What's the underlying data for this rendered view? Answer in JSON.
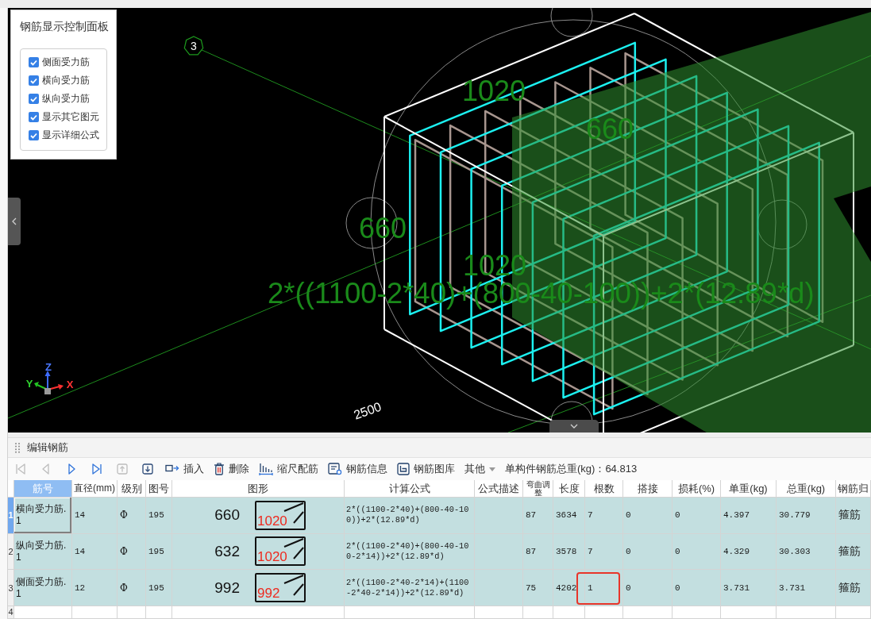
{
  "viewport": {
    "axis_marker": "3",
    "dimension_labels": [
      "1020",
      "660",
      "660",
      "1020"
    ],
    "formula_label": "2*((1100-2*40)+(800-40-100))+2*(12.89*d)",
    "length_label": "2500",
    "axis_letters": [
      "Z",
      "Y",
      "X"
    ]
  },
  "control_panel": {
    "title": "钢筋显示控制面板",
    "options": [
      {
        "label": "侧面受力筋",
        "checked": true
      },
      {
        "label": "横向受力筋",
        "checked": true
      },
      {
        "label": "纵向受力筋",
        "checked": true
      },
      {
        "label": "显示其它图元",
        "checked": true
      },
      {
        "label": "显示详细公式",
        "checked": true
      }
    ]
  },
  "edit_panel": {
    "title": "编辑钢筋",
    "navigation": [
      {
        "kind": "first",
        "disabled": true
      },
      {
        "kind": "previous",
        "disabled": true
      },
      {
        "kind": "next",
        "disabled": false
      },
      {
        "kind": "last",
        "disabled": false
      },
      {
        "kind": "up",
        "disabled": true
      },
      {
        "kind": "down",
        "disabled": false
      }
    ],
    "actions": [
      {
        "kind": "insert",
        "label": "插入"
      },
      {
        "kind": "delete",
        "label": "删除"
      },
      {
        "kind": "scale",
        "label": "缩尺配筋"
      },
      {
        "kind": "info",
        "label": "钢筋信息"
      },
      {
        "kind": "library",
        "label": "钢筋图库"
      },
      {
        "kind": "more",
        "label": "其他"
      }
    ],
    "total_weight": "单构件钢筋总重(kg)：64.813"
  },
  "table": {
    "columns": [
      {
        "label": "筋号",
        "selected": true
      },
      {
        "label": "直径(mm)",
        "selected": false
      },
      {
        "label": "级别",
        "selected": false
      },
      {
        "label": "图号",
        "selected": false
      },
      {
        "label": "图形",
        "selected": false
      },
      {
        "label": "计算公式",
        "selected": false
      },
      {
        "label": "公式描述",
        "selected": false
      },
      {
        "label": "弯曲调整",
        "selected": false
      },
      {
        "label": "长度",
        "selected": false
      },
      {
        "label": "根数",
        "selected": false
      },
      {
        "label": "搭接",
        "selected": false
      },
      {
        "label": "损耗(%)",
        "selected": false
      },
      {
        "label": "单重(kg)",
        "selected": false
      },
      {
        "label": "总重(kg)",
        "selected": false
      },
      {
        "label": "钢筋归",
        "selected": false
      }
    ],
    "rows": [
      {
        "number": "1",
        "selected": true,
        "bar_no": "横向受力筋.1",
        "diameter": "14",
        "grade": "Φ",
        "shape_no": "195",
        "shape": {
          "dimension": "660",
          "inner": "1020"
        },
        "formula": "2*((1100-2*40)+(800-40-100))+2*(12.89*d)",
        "bend_adjust": "87",
        "length": "3634",
        "count": "7",
        "count_marked": false,
        "lap": "0",
        "loss": "0",
        "unit_weight": "4.397",
        "total_weight": "30.779",
        "category": "箍筋"
      },
      {
        "number": "2",
        "selected": false,
        "bar_no": "纵向受力筋.1",
        "diameter": "14",
        "grade": "Φ",
        "shape_no": "195",
        "shape": {
          "dimension": "632",
          "inner": "1020"
        },
        "formula": "2*((1100-2*40)+(800-40-100-2*14))+2*(12.89*d)",
        "bend_adjust": "87",
        "length": "3578",
        "count": "7",
        "count_marked": false,
        "lap": "0",
        "loss": "0",
        "unit_weight": "4.329",
        "total_weight": "30.303",
        "category": "箍筋"
      },
      {
        "number": "3",
        "selected": false,
        "bar_no": "侧面受力筋.1",
        "diameter": "12",
        "grade": "Φ",
        "shape_no": "195",
        "shape": {
          "dimension": "992",
          "inner": "992"
        },
        "formula": "2*((1100-2*40-2*14)+(1100-2*40-2*14))+2*(12.89*d)",
        "bend_adjust": "75",
        "length": "4202",
        "count": "1",
        "count_marked": true,
        "lap": "0",
        "loss": "0",
        "unit_weight": "3.731",
        "total_weight": "3.731",
        "category": "箍筋"
      }
    ],
    "blank_rows": [
      {
        "number": "4"
      }
    ]
  }
}
